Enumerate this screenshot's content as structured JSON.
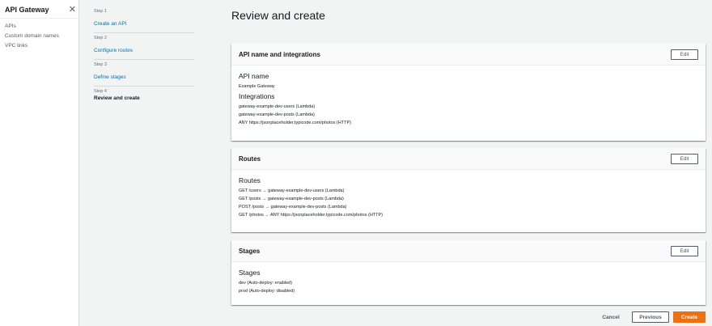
{
  "sidebar": {
    "title": "API Gateway",
    "close_glyph": "✕",
    "items": [
      {
        "label": "APIs"
      },
      {
        "label": "Custom domain names"
      },
      {
        "label": "VPC links"
      }
    ]
  },
  "steps": [
    {
      "num": "Step 1",
      "label": "Create an API"
    },
    {
      "num": "Step 2",
      "label": "Configure routes"
    },
    {
      "num": "Step 3",
      "label": "Define stages"
    },
    {
      "num": "Step 4",
      "label": "Review and create"
    }
  ],
  "page_title": "Review and create",
  "cards": {
    "api": {
      "title": "API name and integrations",
      "edit_label": "Edit",
      "api_name_heading": "API name",
      "api_name": "Example Gateway",
      "integrations_heading": "Integrations",
      "integrations": [
        "gateway-example-dev-users (Lambda)",
        "gateway-example-dev-posts (Lambda)",
        "ANY https://jsonplaceholder.typicode.com/photos (HTTP)"
      ]
    },
    "routes": {
      "title": "Routes",
      "edit_label": "Edit",
      "heading": "Routes",
      "items": [
        "GET /users → gateway-example-dev-users (Lambda)",
        "GET /posts → gateway-example-dev-posts (Lambda)",
        "POST /posts → gateway-example-dev-posts (Lambda)",
        "GET /photos → ANY https://jsonplaceholder.typicode.com/photos (HTTP)"
      ]
    },
    "stages": {
      "title": "Stages",
      "edit_label": "Edit",
      "heading": "Stages",
      "items": [
        "dev (Auto-deploy: enabled)",
        "prod (Auto-deploy: disabled)"
      ]
    }
  },
  "footer": {
    "cancel_label": "Cancel",
    "previous_label": "Previous",
    "create_label": "Create"
  },
  "colors": {
    "link": "#0073bb",
    "primary": "#ec7211",
    "background": "#f2f3f3"
  }
}
